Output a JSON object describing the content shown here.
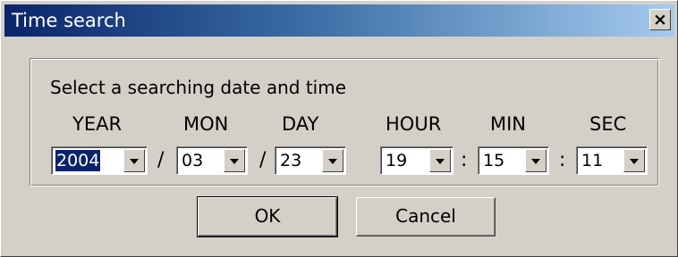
{
  "window": {
    "title": "Time search",
    "close_label": "×"
  },
  "prompt": "Select a searching date and time",
  "fields": [
    {
      "label": "YEAR",
      "value": "2004"
    },
    {
      "label": "MON",
      "value": "03"
    },
    {
      "label": "DAY",
      "value": "23"
    },
    {
      "label": "HOUR",
      "value": "19"
    },
    {
      "label": "MIN",
      "value": "15"
    },
    {
      "label": "SEC",
      "value": "11"
    }
  ],
  "separators": {
    "date": "/",
    "time": ":"
  },
  "buttons": {
    "ok": "OK",
    "cancel": "Cancel"
  }
}
